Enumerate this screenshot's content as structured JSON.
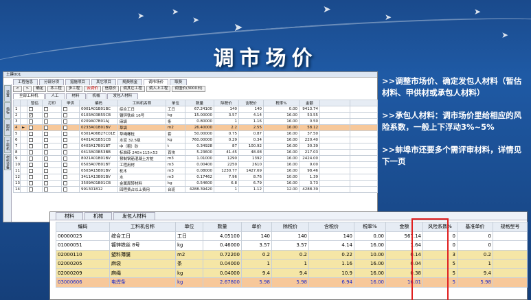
{
  "slide": {
    "title": "调市场价"
  },
  "bullets": [
    ">>调整市场价、确定发包人材料（暂估材料、甲供材或承包人材料）",
    ">>承包人材料：调市场价里给相应的风险系数，一般上下浮动3%~5%",
    ">>蚌埠市还要多个需评审材料，详情见下一页"
  ],
  "app": {
    "window_title": "土建001",
    "module_tabs": [
      "工程信息",
      "分部分项",
      "措施项目",
      "其它项目",
      "规费税金",
      "调市场价",
      "取费"
    ],
    "active_module": "调市场价",
    "side_toolbar": [
      "设置",
      "指标",
      "图形",
      "工料机",
      "材料设备"
    ],
    "actions": [
      "<",
      ">",
      "确定",
      "本工程",
      "多工程",
      "云调价",
      "信息价",
      "调其它工程",
      "调入上工程",
      "调值价(3000日)"
    ],
    "red_action": "云调价",
    "resource_tabs": [
      "全部工料机",
      "人工",
      "材料",
      "机械",
      "发包人材料"
    ],
    "grid_columns": [
      "",
      "",
      "暂估",
      "打印",
      "甲供",
      "编码",
      "工料机名称",
      "单位",
      "数量",
      "除税价",
      "含税价",
      "税率%",
      "金额",
      "",
      ""
    ],
    "grid_rows": [
      {
        "no": "1",
        "code": "0001A01B01BC",
        "name": "综合工日",
        "unit": "工日",
        "qty": "67.24100",
        "pre": "140",
        "tax": "140",
        "rate": "0.00",
        "amt": "9413.74",
        "sel": false,
        "est": false
      },
      {
        "no": "2",
        "code": "0103A03B55CB",
        "name": "镀锌铁丝 16号",
        "unit": "kg",
        "qty": "15.00000",
        "pre": "3.57",
        "tax": "4.14",
        "rate": "16.00",
        "amt": "53.55",
        "sel": false,
        "est": true
      },
      {
        "no": "3",
        "code": "0209A07B01AJ",
        "name": "麻袋",
        "unit": "条",
        "qty": "0.80000",
        "pre": "1",
        "tax": "1.16",
        "rate": "16.00",
        "amt": "0.50",
        "sel": false,
        "est": false
      },
      {
        "no": "4",
        "code": "0233A01B01BV",
        "name": "草袋",
        "unit": "m2",
        "qty": "26.40000",
        "pre": "2.2",
        "tax": "2.55",
        "rate": "16.00",
        "amt": "58.12",
        "sel": true,
        "est": false
      },
      {
        "no": "5",
        "code": "0301A06B27C01E",
        "name": "草绳螺栓",
        "unit": "套",
        "qty": "50.00000",
        "pre": "0.75",
        "tax": "0.87",
        "rate": "16.00",
        "amt": "37.50",
        "sel": false,
        "est": false
      },
      {
        "no": "6",
        "code": "0401A01B51CB",
        "name": "水泥 32.5级",
        "unit": "kg",
        "qty": "760.00000",
        "pre": "0.29",
        "tax": "0.34",
        "rate": "16.00",
        "amt": "220.40",
        "sel": false,
        "est": false
      },
      {
        "no": "7",
        "code": "0403A17B01BT",
        "name": "中（粗）砂",
        "unit": "t",
        "qty": "0.34928",
        "pre": "87",
        "tax": "100.92",
        "rate": "16.00",
        "amt": "30.39",
        "sel": false,
        "est": false
      },
      {
        "no": "8",
        "code": "0413A03B53BB",
        "name": "标准砖 240×115×53",
        "unit": "百块",
        "qty": "5.23600",
        "pre": "41.45",
        "tax": "48.08",
        "rate": "16.00",
        "amt": "217.03",
        "sel": false,
        "est": false
      },
      {
        "no": "9",
        "code": "8021A01B01BV",
        "name": "预制钢筋混凝土方桩",
        "unit": "m3",
        "qty": "1.01000",
        "pre": "1290",
        "tax": "1392",
        "rate": "16.00",
        "amt": "2424.00",
        "sel": false,
        "est": false
      },
      {
        "no": "10",
        "code": "0503A07B01BT",
        "name": "工程用材",
        "unit": "m3",
        "qty": "0.00400",
        "pre": "2250",
        "tax": "2610",
        "rate": "16.00",
        "amt": "9.00",
        "sel": false,
        "est": false
      },
      {
        "no": "11",
        "code": "0503A15B01BV",
        "name": "枕木",
        "unit": "m3",
        "qty": "0.08000",
        "pre": "1230.77",
        "tax": "1427.69",
        "rate": "16.00",
        "amt": "98.46",
        "sel": false,
        "est": false
      },
      {
        "no": "12",
        "code": "3411A13B01BV",
        "name": "水",
        "unit": "m3",
        "qty": "0.17462",
        "pre": "7.96",
        "tax": "8.76",
        "rate": "10.00",
        "amt": "1.39",
        "sel": false,
        "est": false
      },
      {
        "no": "13",
        "code": "3509A01B01CB",
        "name": "金属周转材料",
        "unit": "kg",
        "qty": "0.54600",
        "pre": "6.8",
        "tax": "6.79",
        "rate": "16.00",
        "amt": "3.73",
        "sel": false,
        "est": false
      },
      {
        "no": "14",
        "code": "991301812",
        "name": "回程费占以上费用",
        "unit": "台班",
        "qty": "4288.39420",
        "pre": "1",
        "tax": "1.12",
        "rate": "12.00",
        "amt": "4288.39",
        "sel": false,
        "est": false
      }
    ]
  },
  "zoom": {
    "tabs": [
      "材料",
      "机械",
      "发包人材料"
    ],
    "columns": [
      "编码",
      "工料机名称",
      "单位",
      "数量",
      "单价",
      "除税价",
      "含税价",
      "税率%",
      "金额",
      "风险系数%",
      "基准单价",
      "规格型号"
    ],
    "rows": [
      {
        "code": "00000025",
        "name": "综合工日",
        "unit": "工日",
        "qty": "4.05100",
        "price": "140",
        "pre": "140",
        "tax": "140",
        "rate": "0.00",
        "amt": "567.14",
        "risk": "0",
        "base": "0",
        "cls": ""
      },
      {
        "code": "01000051",
        "name": "镀锌铁丝 8号",
        "unit": "kg",
        "qty": "0.46000",
        "price": "3.57",
        "pre": "3.57",
        "tax": "4.14",
        "rate": "16.00",
        "amt": "1.64",
        "risk": "0",
        "base": "0",
        "cls": ""
      },
      {
        "code": "02000110",
        "name": "塑料薄膜",
        "unit": "m2",
        "qty": "0.72200",
        "price": "0.2",
        "pre": "0.2",
        "tax": "0.22",
        "rate": "10.00",
        "amt": "0.14",
        "risk": "3",
        "base": "0.2",
        "cls": "hl"
      },
      {
        "code": "02000205",
        "name": "麻袋",
        "unit": "条",
        "qty": "0.04000",
        "price": "1",
        "pre": "1",
        "tax": "1.16",
        "rate": "16.00",
        "amt": "0.04",
        "risk": "5",
        "base": "1",
        "cls": "hl"
      },
      {
        "code": "02000209",
        "name": "麻绳",
        "unit": "kg",
        "qty": "0.04000",
        "price": "9.4",
        "pre": "9.4",
        "tax": "10.9",
        "rate": "16.00",
        "amt": "0.38",
        "risk": "5",
        "base": "9.4",
        "cls": "hl"
      },
      {
        "code": "03000606",
        "name": "电焊条",
        "unit": "kg",
        "qty": "2.67800",
        "price": "5.98",
        "pre": "5.98",
        "tax": "6.94",
        "rate": "16.00",
        "amt": "16.01",
        "risk": "5",
        "base": "5.98",
        "cls": "blue"
      }
    ]
  }
}
